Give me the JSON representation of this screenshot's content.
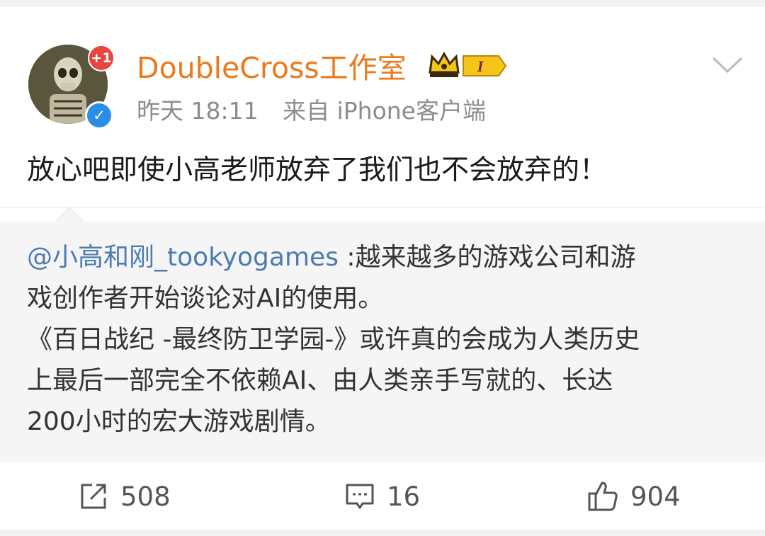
{
  "post": {
    "username": "DoubleCross工作室",
    "level_badge": "I",
    "avatar_badge": "+1",
    "time": "昨天 18:11",
    "source": "来自 iPhone客户端",
    "text": "放心吧即使小高老师放弃了我们也不会放弃的！"
  },
  "repost": {
    "mention": "@小高和刚_tookyogames",
    "line1_rest": " :越来越多的游戏公司和游",
    "line2": "戏创作者开始谈论对AI的使用。",
    "line3": "《百日战纪 -最终防卫学园-》或许真的会成为人类历史",
    "line4": "上最后一部完全不依赖AI、由人类亲手写就的、长达",
    "line5": "200小时的宏大游戏剧情。"
  },
  "actions": {
    "repost_count": "508",
    "comment_count": "16",
    "like_count": "904"
  },
  "colors": {
    "username": "#ea7a1c",
    "mention": "#4c7bb3",
    "verified": "#2a8ee6",
    "badge": "#e8453c"
  }
}
